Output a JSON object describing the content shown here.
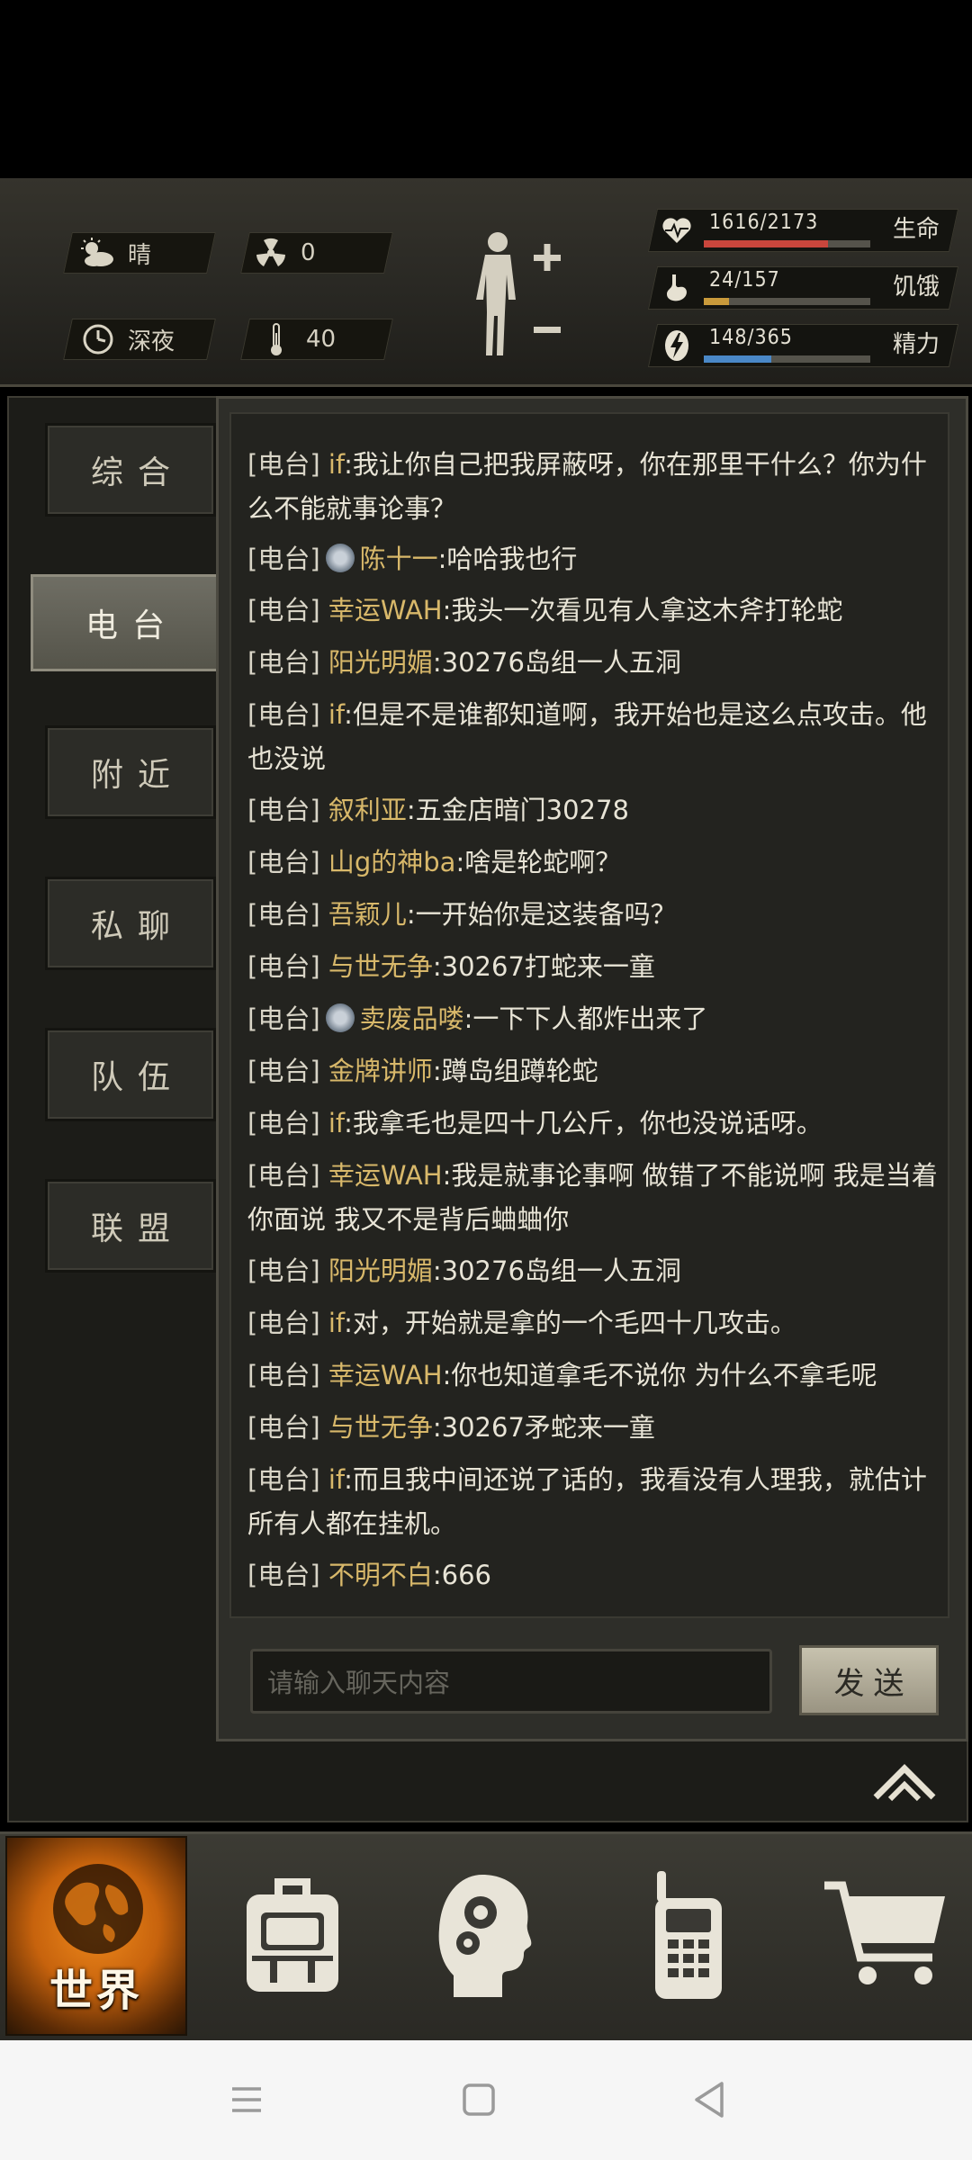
{
  "status": {
    "weather": "晴",
    "radiation": "0",
    "time_of_day": "深夜",
    "temperature": "40"
  },
  "stats": [
    {
      "icon": "heart-icon",
      "value": "1616/2173",
      "label": "生命",
      "fraction": 0.744,
      "color": "#c9463c"
    },
    {
      "icon": "stomach-icon",
      "value": "24/157",
      "label": "饥饿",
      "fraction": 0.153,
      "color": "#c99a3b"
    },
    {
      "icon": "lightning-icon",
      "value": "148/365",
      "label": "精力",
      "fraction": 0.405,
      "color": "#4a88c7"
    }
  ],
  "tabs": [
    {
      "label": "综合",
      "active": false
    },
    {
      "label": "电台",
      "active": true
    },
    {
      "label": "附近",
      "active": false
    },
    {
      "label": "私聊",
      "active": false
    },
    {
      "label": "队伍",
      "active": false
    },
    {
      "label": "联盟",
      "active": false
    }
  ],
  "messages": [
    {
      "tag": "[电台]",
      "name": "if",
      "badge": false,
      "text": ":我让你自己把我屏蔽呀，你在那里干什么？你为什么不能就事论事？"
    },
    {
      "tag": "[电台]",
      "name": "陈十一",
      "badge": true,
      "text": ":哈哈我也行"
    },
    {
      "tag": "[电台]",
      "name": "幸运WAH",
      "badge": false,
      "text": ":我头一次看见有人拿这木斧打轮蛇"
    },
    {
      "tag": "[电台]",
      "name": "阳光明媚",
      "badge": false,
      "text": ":30276岛组一人五洞"
    },
    {
      "tag": "[电台]",
      "name": "if",
      "badge": false,
      "text": ":但是不是谁都知道啊，我开始也是这么点攻击。他也没说"
    },
    {
      "tag": "[电台]",
      "name": "叙利亚",
      "badge": false,
      "text": ":五金店暗门30278"
    },
    {
      "tag": "[电台]",
      "name": "山g的神ba",
      "badge": false,
      "text": ":啥是轮蛇啊？"
    },
    {
      "tag": "[电台]",
      "name": "吾颖儿",
      "badge": false,
      "text": ":一开始你是这装备吗？"
    },
    {
      "tag": "[电台]",
      "name": "与世无争",
      "badge": false,
      "text": ":30267打蛇来一童"
    },
    {
      "tag": "[电台]",
      "name": "卖废品喽",
      "badge": true,
      "text": ":一下下人都炸出来了"
    },
    {
      "tag": "[电台]",
      "name": "金牌讲师",
      "badge": false,
      "text": ":蹲岛组蹲轮蛇"
    },
    {
      "tag": "[电台]",
      "name": "if",
      "badge": false,
      "text": ":我拿毛也是四十几公斤，你也没说话呀。"
    },
    {
      "tag": "[电台]",
      "name": "幸运WAH",
      "badge": false,
      "text": ":我是就事论事啊 做错了不能说啊 我是当着你面说 我又不是背后蛐蛐你"
    },
    {
      "tag": "[电台]",
      "name": "阳光明媚",
      "badge": false,
      "text": ":30276岛组一人五洞"
    },
    {
      "tag": "[电台]",
      "name": "if",
      "badge": false,
      "text": ":对，开始就是拿的一个毛四十几攻击。"
    },
    {
      "tag": "[电台]",
      "name": "幸运WAH",
      "badge": false,
      "text": ":你也知道拿毛不说你 为什么不拿毛呢"
    },
    {
      "tag": "[电台]",
      "name": "与世无争",
      "badge": false,
      "text": ":30267矛蛇来一童"
    },
    {
      "tag": "[电台]",
      "name": "if",
      "badge": false,
      "text": ":而且我中间还说了话的，我看没有人理我，就估计所有人都在挂机。"
    },
    {
      "tag": "[电台]",
      "name": "不明不白",
      "badge": false,
      "text": ":666"
    }
  ],
  "chat_input": {
    "placeholder": "请输入聊天内容",
    "value": ""
  },
  "send_label": "发送",
  "nav": {
    "world_label": "世界",
    "items": [
      "globe-icon",
      "backpack-icon",
      "head-gears-icon",
      "walkie-talkie-icon",
      "cart-icon"
    ]
  }
}
